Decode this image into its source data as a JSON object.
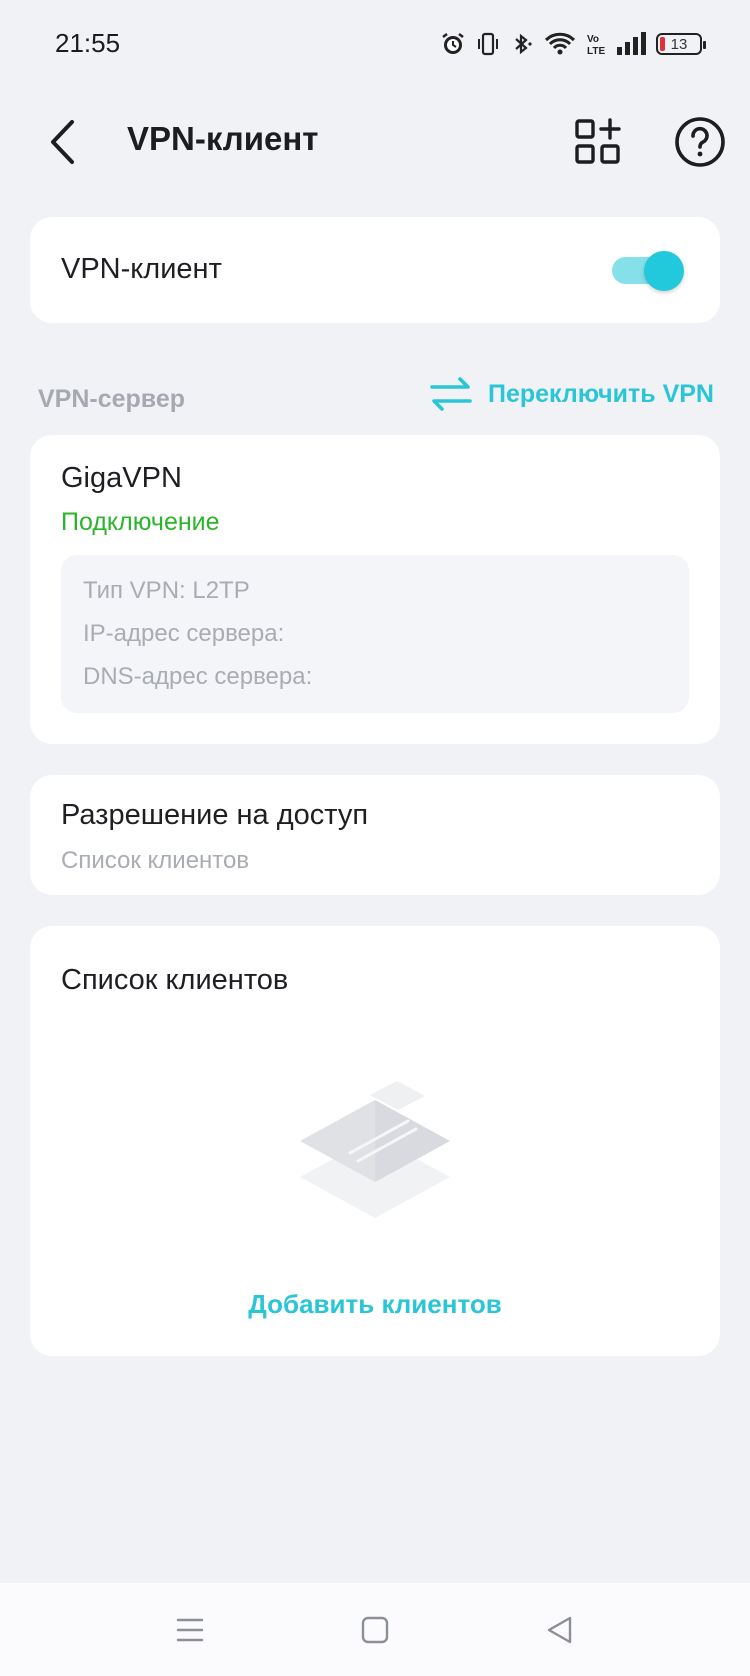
{
  "status_bar": {
    "time": "21:55",
    "battery": "13",
    "icons": [
      "alarm-icon",
      "vibrate-icon",
      "bluetooth-icon",
      "wifi-icon",
      "volte-icon",
      "signal-icon",
      "battery-icon"
    ]
  },
  "appbar": {
    "title": "VPN-клиент",
    "back_icon": "chevron-left-icon",
    "apps_icon": "add-widget-icon",
    "help_icon": "question-icon"
  },
  "vpn_toggle": {
    "label": "VPN-клиент",
    "enabled": true
  },
  "server_section": {
    "label": "VPN-сервер",
    "switch_label": "Переключить VPN",
    "switch_icon": "swap-arrows-icon"
  },
  "server": {
    "name": "GigaVPN",
    "status": "Подключение",
    "vpn_type": "Тип VPN: L2TP",
    "ip_label": "IP-адрес сервера:",
    "dns_label": "DNS-адрес сервера:"
  },
  "access": {
    "title": "Разрешение на доступ",
    "subtitle": "Список клиентов"
  },
  "clients": {
    "title": "Список клиентов",
    "add_label": "Добавить клиентов",
    "empty_icon": "empty-list-icon"
  },
  "navbar": {
    "icons": [
      "menu-icon",
      "home-icon",
      "back-triangle-icon"
    ]
  },
  "colors": {
    "accent": "#2ac5d6",
    "status_green": "#2bb52b",
    "background": "#f1f2f6",
    "muted_text": "#a9acb3"
  }
}
